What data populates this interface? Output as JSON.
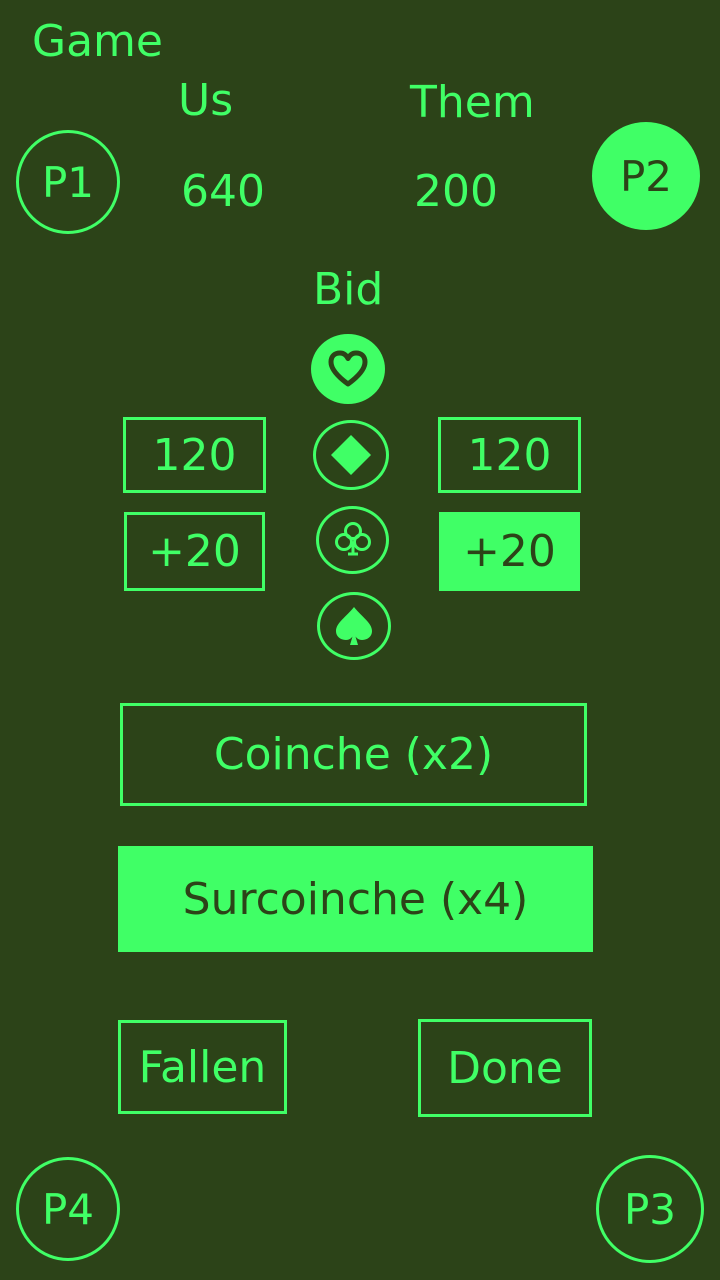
{
  "header": {
    "game_label": "Game",
    "us_label": "Us",
    "them_label": "Them",
    "us_score": "640",
    "them_score": "200"
  },
  "players": {
    "p1": "P1",
    "p2": "P2",
    "p3": "P3",
    "p4": "P4",
    "active": "P2"
  },
  "bid": {
    "label": "Bid",
    "left_value": "120",
    "right_value": "120",
    "left_increment": "+20",
    "right_increment": "+20",
    "selected_suit": "hearts",
    "suits": [
      "hearts",
      "diamonds",
      "clubs",
      "spades"
    ]
  },
  "actions": {
    "coinche": "Coinche (x2)",
    "surcoinche": "Surcoinche (x4)",
    "fallen": "Fallen",
    "done": "Done"
  },
  "colors": {
    "background": "#2c4318",
    "accent": "#40ff66"
  }
}
